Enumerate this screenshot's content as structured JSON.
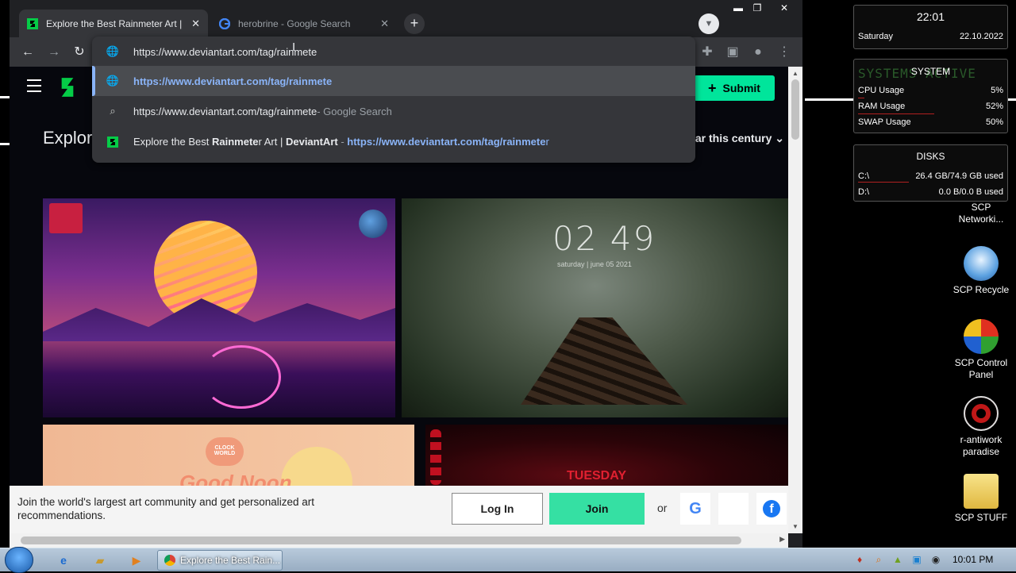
{
  "browser": {
    "tabs": [
      {
        "title": "Explore the Best Rainmeter Art | DeviantArt",
        "active": true
      },
      {
        "title": "herobrine - Google Search",
        "active": false
      }
    ],
    "new_tab": "+",
    "close": "✕"
  },
  "omnibox": {
    "input_value": "https://www.deviantart.com/tag/rainmete",
    "suggestions": [
      {
        "icon": "globe-icon",
        "text": "https://www.deviantart.com/tag/rainmete",
        "suffix": ""
      },
      {
        "icon": "search-icon",
        "text": "https://www.deviantart.com/tag/rainmete",
        "suffix": " - Google Search"
      },
      {
        "icon": "deviantart-icon",
        "title_pre": "Explore the Best ",
        "title_bold": "Rainmete",
        "title_post": "r Art | ",
        "title_bold2": "DeviantArt",
        "sep": " - ",
        "url_bold": "https://www.deviantart.com/tag/rainmete",
        "url_tail": "r"
      }
    ]
  },
  "page": {
    "submit_label": "Submit",
    "explore_title": "Explore",
    "sort_label": "Popular this century",
    "sort_visible": "lar this century",
    "join_text": "Join the world's largest art community and get personalized art recommendations.",
    "login_label": "Log In",
    "join_label": "Join",
    "or_label": "or",
    "art_labels": {
      "clock": "02 49",
      "date": "saturday | june 05 2021",
      "tuesday": "TUESDAY",
      "clockworld": "CLOCK WORLD",
      "goodnoon": "Good Noon"
    }
  },
  "widgets": {
    "time": "22:01",
    "day": "Saturday",
    "date": "22.10.2022",
    "system_title": "SYSTEM",
    "system_bg": "SYSTEMS ACTIVE",
    "system_rows": [
      {
        "label": "CPU Usage",
        "value": "5%",
        "fraction": 0.05
      },
      {
        "label": "RAM Usage",
        "value": "52%",
        "fraction": 0.52
      },
      {
        "label": "SWAP Usage",
        "value": "50%",
        "fraction": 0.5
      }
    ],
    "disks_title": "DISKS",
    "disk_rows": [
      {
        "label": "C:\\",
        "value": "26.4 GB/74.9 GB used",
        "fraction": 0.35
      },
      {
        "label": "D:\\",
        "value": "0.0 B/0.0 B used",
        "fraction": 0
      }
    ]
  },
  "desktop_icons": [
    {
      "label": "SCP Networki...",
      "icon": "network-icon"
    },
    {
      "label": "SCP Recycle",
      "icon": "recycle-bin-icon"
    },
    {
      "label": "SCP Control Panel",
      "icon": "control-panel-icon"
    },
    {
      "label": "r-antiwork paradise",
      "icon": "antiwork-icon"
    },
    {
      "label": "SCP STUFF",
      "icon": "folder-icon"
    }
  ],
  "taskbar": {
    "task_title": "Explore the Best Rain...",
    "time": "10:01 PM"
  },
  "colors": {
    "accent": "#00e59b",
    "link": "#8ab4f8",
    "chrome_dark": "#202124"
  }
}
